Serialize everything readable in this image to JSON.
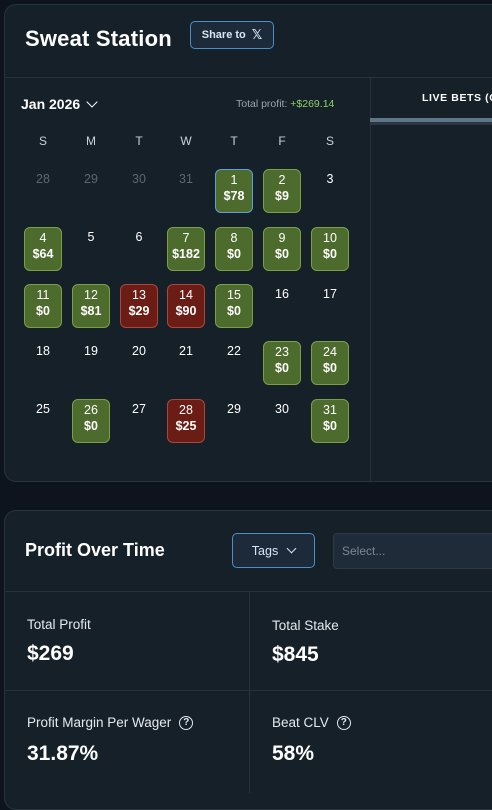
{
  "header": {
    "title": "Sweat Station",
    "share_label": "Share to",
    "share_icon": "x-logo-icon"
  },
  "calendar": {
    "month_label": "Jan 2026",
    "total_profit_label": "Total profit:",
    "total_profit_value": "+$269.14",
    "weekdays": [
      "S",
      "M",
      "T",
      "W",
      "T",
      "F",
      "S"
    ],
    "colors": {
      "win": "#4e6b2e",
      "loss": "#6b1d15",
      "today_border": "#5fa0d8"
    },
    "weeks": [
      [
        {
          "day": "28",
          "muted": true
        },
        {
          "day": "29",
          "muted": true
        },
        {
          "day": "30",
          "muted": true
        },
        {
          "day": "31",
          "muted": true
        },
        {
          "day": "1",
          "amount": "$78",
          "status": "today"
        },
        {
          "day": "2",
          "amount": "$9",
          "status": "win"
        },
        {
          "day": "3"
        }
      ],
      [
        {
          "day": "4",
          "amount": "$64",
          "status": "win"
        },
        {
          "day": "5"
        },
        {
          "day": "6"
        },
        {
          "day": "7",
          "amount": "$182",
          "status": "win"
        },
        {
          "day": "8",
          "amount": "$0",
          "status": "win"
        },
        {
          "day": "9",
          "amount": "$0",
          "status": "win"
        },
        {
          "day": "10",
          "amount": "$0",
          "status": "win"
        }
      ],
      [
        {
          "day": "11",
          "amount": "$0",
          "status": "win"
        },
        {
          "day": "12",
          "amount": "$81",
          "status": "win"
        },
        {
          "day": "13",
          "amount": "$29",
          "status": "loss"
        },
        {
          "day": "14",
          "amount": "$90",
          "status": "loss"
        },
        {
          "day": "15",
          "amount": "$0",
          "status": "win"
        },
        {
          "day": "16"
        },
        {
          "day": "17"
        }
      ],
      [
        {
          "day": "18"
        },
        {
          "day": "19"
        },
        {
          "day": "20"
        },
        {
          "day": "21"
        },
        {
          "day": "22"
        },
        {
          "day": "23",
          "amount": "$0",
          "status": "win"
        },
        {
          "day": "24",
          "amount": "$0",
          "status": "win"
        }
      ],
      [
        {
          "day": "25"
        },
        {
          "day": "26",
          "amount": "$0",
          "status": "win"
        },
        {
          "day": "27"
        },
        {
          "day": "28",
          "amount": "$25",
          "status": "loss"
        },
        {
          "day": "29"
        },
        {
          "day": "30"
        },
        {
          "day": "31",
          "amount": "$0",
          "status": "win"
        }
      ]
    ]
  },
  "live_bets": {
    "tab_label": "LIVE BETS (C"
  },
  "profit_over_time": {
    "title": "Profit Over Time",
    "tags_label": "Tags",
    "select_placeholder": "Select..."
  },
  "stats": {
    "total_profit_label": "Total Profit",
    "total_profit_value": "$269",
    "total_stake_label": "Total Stake",
    "total_stake_value": "$845",
    "margin_label": "Profit Margin Per Wager",
    "margin_value": "31.87%",
    "beat_clv_label": "Beat CLV",
    "beat_clv_value": "58%"
  }
}
